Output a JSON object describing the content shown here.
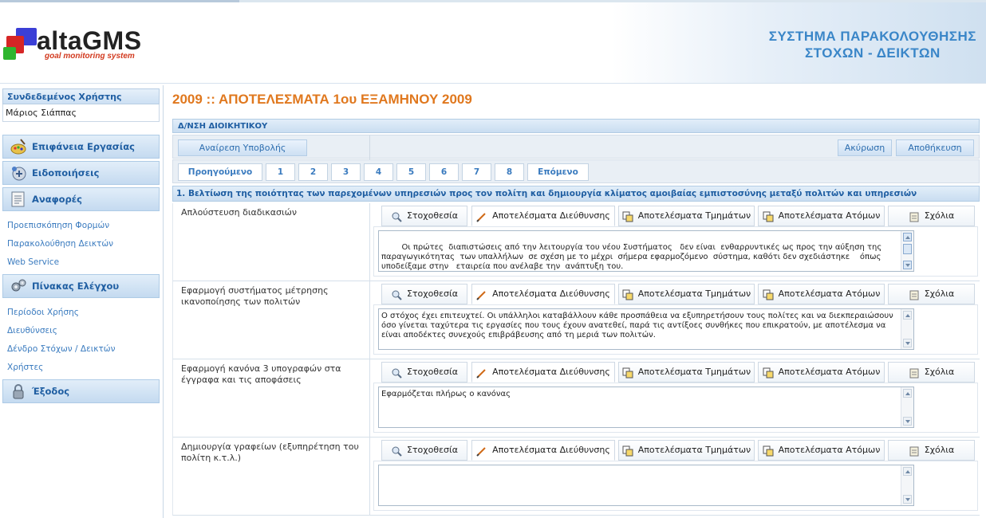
{
  "app": {
    "logo_name": "altaGMS",
    "logo_tagline": "goal monitoring system",
    "system_title_line1": "ΣΥΣΤΗΜΑ ΠΑΡΑΚΟΛΟΥΘΗΣΗΣ",
    "system_title_line2": "ΣΤΟΧΩΝ - ΔΕΙΚΤΩΝ"
  },
  "sidebar": {
    "user_title": "Συνδεδεμένος Χρήστης",
    "user_name": "Μάριος Σιάππας",
    "sections": {
      "desktop": "Επιφάνεια Εργασίας",
      "notifications": "Ειδοποιήσεις",
      "reports": "Αναφορές",
      "control_panel": "Πίνακας Ελέγχου",
      "logout": "Έξοδος"
    },
    "report_links": [
      "Προεπισκόπηση Φορμών",
      "Παρακολούθηση Δεικτών",
      "Web Service"
    ],
    "control_links": [
      "Περίοδοι Χρήσης",
      "Διευθύνσεις",
      "Δένδρο Στόχων / Δεικτών",
      "Χρήστες"
    ]
  },
  "main": {
    "page_title": "2009 :: ΑΠΟΤΕΛΕΣΜΑΤΑ 1ου ΕΞΑΜΗΝΟΥ 2009",
    "section_title": "Δ/ΝΣΗ ΔΙΟΙΚΗΤΙΚΟΥ",
    "toolbar": {
      "withdraw_label": "Αναίρεση Υποβολής",
      "cancel_label": "Ακύρωση",
      "save_label": "Αποθήκευση"
    },
    "pager": {
      "prev_label": "Προηγούμενο",
      "pages": [
        "1",
        "2",
        "3",
        "4",
        "5",
        "6",
        "7",
        "8"
      ],
      "next_label": "Επόμενο"
    },
    "goal_title": "1. Βελτίωση της ποιότητας των παρεχομένων υπηρεσιών προς τον πολίτη και δημιουργία κλίματος αμοιβαίας εμπιστοσύνης μεταξύ πολιτών και υπηρεσιών",
    "tabs": [
      "Στοχοθεσία",
      "Αποτελέσματα Διεύθυνσης",
      "Αποτελέσματα Τμημάτων",
      "Αποτελέσματα Ατόμων",
      "Σχόλια"
    ],
    "rows": [
      {
        "label": "Απλούστευση διαδικασιών",
        "text": "Οι πρώτες  διαπιστώσεις από την λειτουργία του νέου Συστήματος   δεν είναι  ενθαρρυντικές ως προς την αύξηση της παραγωγικότητας  των υπαλλήλων  σε σχέση με το μέχρι  σήμερα εφαρμοζόμενο  σύστημα, καθότι δεν σχεδιάστηκε    όπως υποδείξαμε στην   εταιρεία που ανέλαβε την  ανάπτυξη του.\nΕπιπλέον  παρατηρούνται  πλείστες καθυστερήσεις λόγω κακής ποιότητας  συνδέσεως με το  Διαδίκτυο."
      },
      {
        "label": "Εφαρμογή συστήματος μέτρησης ικανοποίησης των πολιτών",
        "text": "Ο στόχος έχει επιτευχτεί. Οι υπάλληλοι καταβάλλουν κάθε προσπάθεια να εξυπηρετήσουν τους πολίτες και να διεκπεραιώσουν όσο γίνεται ταχύτερα τις  εργασίες που τους έχουν ανατεθεί, παρά τις αντίξοες συνθήκες που επικρατούν, με αποτέλεσμα να είναι αποδέκτες συνεχούς επιβράβευσης από τη μεριά των πολιτών."
      },
      {
        "label": "Εφαρμογή κανόνα 3 υπογραφών στα έγγραφα και τις αποφάσεις",
        "text": "Εφαρμόζεται πλήρως ο κανόνας"
      },
      {
        "label": "Δημιουργία γραφείων (εξυπηρέτηση του πολίτη κ.τ.λ.)",
        "text": ""
      }
    ]
  },
  "colors": {
    "accent_blue": "#1f5ea2",
    "title_orange": "#e0781e",
    "link_blue": "#3a7bbf"
  }
}
